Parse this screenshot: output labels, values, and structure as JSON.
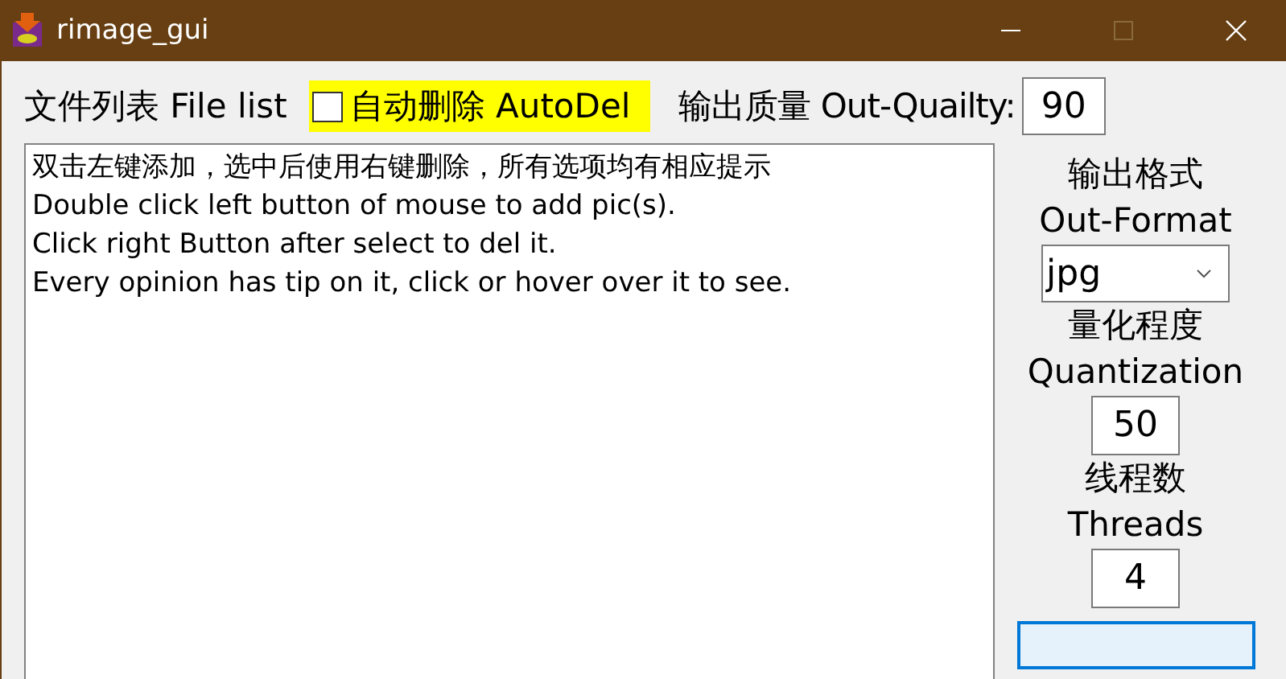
{
  "window": {
    "title": "rimage_gui"
  },
  "file_list": {
    "label": "文件列表 File list",
    "lines": [
      "双击左键添加，选中后使用右键删除，所有选项均有相应提示",
      "Double click left button of mouse to add pic(s).",
      "Click right Button after select to del it.",
      "Every opinion has tip on it, click or hover over it to see."
    ]
  },
  "auto_delete": {
    "label": "自动删除 AutoDel",
    "checked": false
  },
  "quality": {
    "label": "输出质量 Out-Quailty:",
    "value": "90"
  },
  "format": {
    "label_cn": "输出格式",
    "label_en": "Out-Format",
    "value": "jpg"
  },
  "quantization": {
    "label_cn": "量化程度",
    "label_en": "Quantization",
    "value": "50"
  },
  "threads": {
    "label_cn": "线程数",
    "label_en": "Threads",
    "value": "4"
  }
}
